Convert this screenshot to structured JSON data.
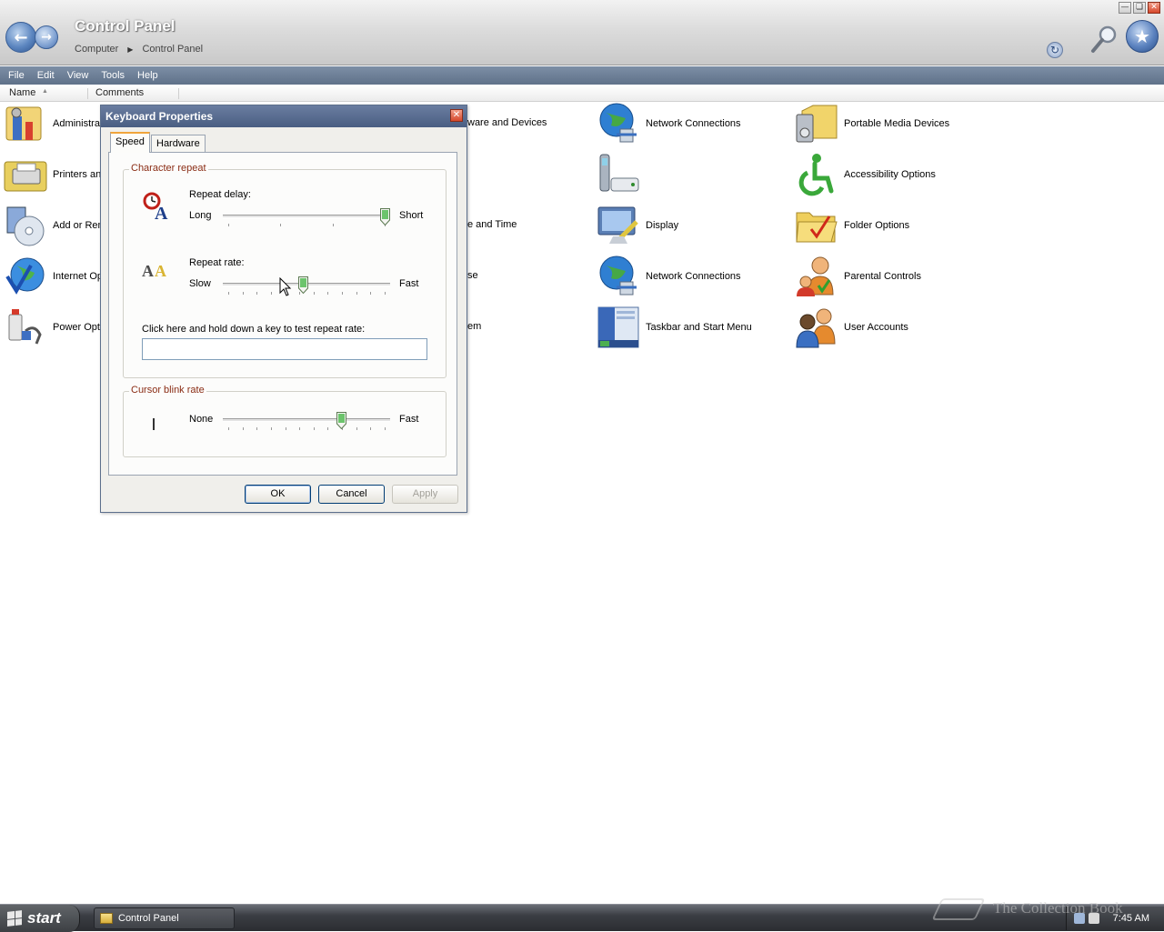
{
  "window": {
    "title": "Control Panel",
    "breadcrumb": [
      "Computer",
      "Control Panel"
    ],
    "controls": [
      "minimize",
      "restore",
      "close"
    ]
  },
  "menu": [
    "File",
    "Edit",
    "View",
    "Tools",
    "Help"
  ],
  "columns": {
    "name": "Name",
    "comments": "Comments"
  },
  "items": {
    "admin_tools": "Administrat",
    "printers": "Printers an",
    "add_remove": "Add or Rem",
    "internet_options": "Internet Op",
    "power_options": "Power Opti",
    "hardware_devices": "ware and Devices",
    "date_time": "e and Time",
    "mouse": "se",
    "system": "em",
    "network_connections_1": "Network Connections",
    "phone_modem": "",
    "display": "Display",
    "network_connections_2": "Network Connections",
    "taskbar_start": "Taskbar and Start Menu",
    "portable_media": "Portable Media Devices",
    "accessibility": "Accessibility Options",
    "folder_options": "Folder Options",
    "parental_controls": "Parental Controls",
    "user_accounts": "User Accounts"
  },
  "dialog": {
    "title": "Keyboard Properties",
    "tabs": [
      "Speed",
      "Hardware"
    ],
    "active_tab": "Speed",
    "character_repeat": {
      "group_title": "Character repeat",
      "repeat_delay_label": "Repeat delay:",
      "delay_min_label": "Long",
      "delay_max_label": "Short",
      "delay_value": 1.0,
      "repeat_rate_label": "Repeat rate:",
      "rate_min_label": "Slow",
      "rate_max_label": "Fast",
      "rate_value": 0.48,
      "test_label": "Click here and hold down a key to test repeat rate:",
      "test_value": ""
    },
    "cursor_blink": {
      "group_title": "Cursor blink rate",
      "min_label": "None",
      "max_label": "Fast",
      "value": 0.72
    },
    "buttons": {
      "ok": "OK",
      "cancel": "Cancel",
      "apply": "Apply"
    }
  },
  "taskbar": {
    "start_label": "start",
    "task_label": "Control Panel",
    "clock": "7:45 AM"
  },
  "watermark": "The Collection Book",
  "colors": {
    "accent": "#4a5e82",
    "group_title": "#8a2c14",
    "menubar": "#6b7d95"
  }
}
